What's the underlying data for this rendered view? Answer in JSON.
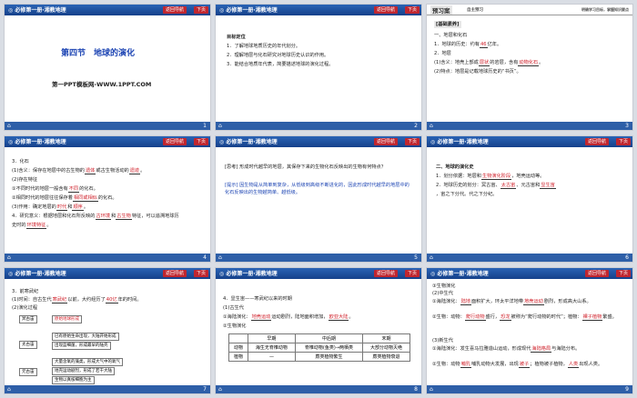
{
  "header": {
    "brand": "◎ 必修第一册·湘教地理",
    "nav_back": "返回导航",
    "nav_next": "下页"
  },
  "slides": [
    {
      "page": "1",
      "title": "第四节　地球的演化",
      "subtitle": "第一PPT模板网-WWW.1PPT.COM"
    },
    {
      "page": "2",
      "heading": "目标定位",
      "lines": [
        "1．了解地球地质历史的年代划分。",
        "2．理解地层与化石研究对地球历史认识的作用。",
        "3．能结合地质年代表，简要描述地球的演化过程。"
      ]
    },
    {
      "page": "3",
      "banner": "预习案",
      "banner_sub": "自主预习",
      "banner_right": "明确学习目标，掌握知识要点",
      "section": "[基础素养]",
      "lines": [
        "一、地层和化石",
        "1．地球的历史：约有",
        "亿年。",
        "2．地层",
        "(1)含义：地壳上部成",
        "的岩层，含有",
        "。",
        "(2)特点：地层是记载地球历史的“书页”。"
      ],
      "fills": [
        "46",
        "层状",
        "化石",
        "动物化石"
      ]
    },
    {
      "page": "4",
      "lines": [
        "3．化石",
        "(1)含义：保存在地层中的古生物的",
        "或古生物活动的",
        "。",
        "(2)存在特征",
        "①不同时代的地层一般含有",
        "的化石。",
        "②相同时代的地层往往保存着",
        "的化石。",
        "(3)作用：确定地层的",
        "和",
        "。",
        "4．研究意义：根据地层和化石所反映的",
        "和",
        "特征，可以追溯地球历",
        "史时的",
        "。"
      ],
      "fills": [
        "遗体",
        "遗迹",
        "不同",
        "相同或相似",
        "时代",
        "顺序",
        "古环境",
        "古生物",
        "环境特征"
      ]
    },
    {
      "page": "5",
      "lines": [
        "[思考] 形成时代越早的地层，其保存下来的生物化石反映出的生物有何特点？",
        "[提示] 因生物是从简单到复杂，从低级到高级不断进化的，因此形成时代越早的地层中的化石反映出的生物越简单、越低级。"
      ]
    },
    {
      "page": "6",
      "lines": [
        "二、地球的演化史",
        "1．划分依据：地层和",
        "，地壳运动等。",
        "2．地球历史的划分：冥古宙、",
        "、元古宙和",
        "，宙之下分代。代之下分纪。"
      ],
      "fills": [
        "生物演化阶段",
        "太古宙",
        "显生宙"
      ]
    },
    {
      "page": "7",
      "lines": [
        "3．前寒武纪",
        "(1)时间：自古生代",
        "以前，大约经历了",
        "年的时间。",
        "(2)演化过程"
      ],
      "fills": [
        "寒武纪",
        "40亿"
      ],
      "diagram": {
        "eras": [
          "冥古宙",
          "太古宙",
          "元古宙"
        ],
        "notes": [
          "原始地球形成",
          "已有原始生命出现，大陆开始形成",
          "出现蓝细菌，形成最早的陆壳",
          "大量含氧的藻类，形成大气中的氧气",
          "地壳运动剧烈，形成了若干大陆",
          "生物以真核细胞为主"
        ]
      }
    },
    {
      "page": "8",
      "lines": [
        "4．显生宙——寒武纪以来的时期",
        "(1)古生代",
        "①海陆演化：",
        "运动剧烈，陆地面积增加，",
        "形成",
        "。",
        "②生物演化"
      ],
      "fills": [
        "地壳运动",
        "欧亚大陆"
      ],
      "table": {
        "headers": [
          "",
          "早期",
          "中后期",
          "末期"
        ],
        "rows": [
          [
            "动物",
            "海生无脊椎动物",
            "脊椎动物(鱼类)→两栖类",
            "大部分动物灭绝"
          ],
          [
            "植物",
            "—",
            "蕨类植物繁生",
            "蕨类植物衰退"
          ]
        ]
      }
    },
    {
      "page": "9",
      "lines": [
        "③生物演化",
        "(2)中生代",
        "①海陆演化：",
        "面积扩大，环太平洋地带",
        "剧烈，形成高大山系。",
        "②生物：动物：",
        "盛行，",
        "被称为“爬行动物的时代”；植物：",
        "繁盛。",
        "(3)新生代",
        "①海陆演化：发生喜马拉雅造山运动，形成现代",
        "与海陆分布。",
        "②生物：动物",
        "哺乳动物大发展，出现",
        "；植物",
        "被子植物，",
        "出现人类。"
      ],
      "fills": [
        "陆地",
        "地壳运动",
        "爬行动物",
        "恐龙",
        "裸子植物",
        "海陆格局",
        "哺乳",
        "被子",
        "人类"
      ]
    }
  ]
}
